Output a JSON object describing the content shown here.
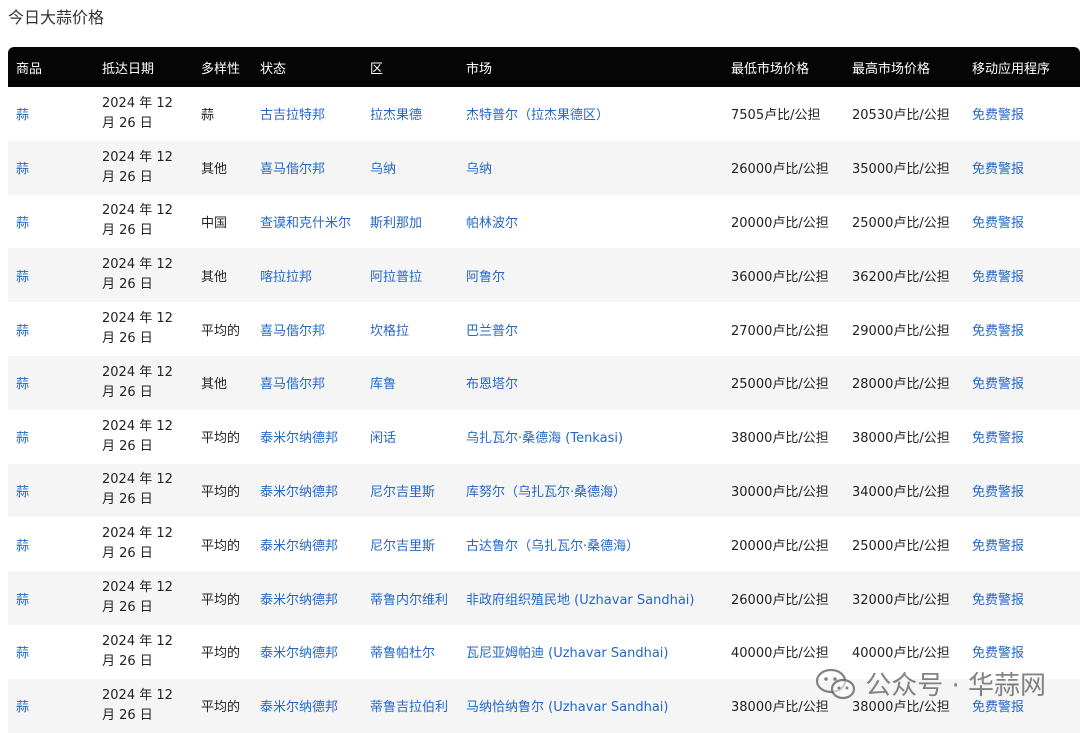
{
  "title": "今日大蒜价格",
  "columns": [
    "商品",
    "抵达日期",
    "多样性",
    "状态",
    "区",
    "市场",
    "最低市场价格",
    "最高市场价格",
    "移动应用程序"
  ],
  "rows": [
    {
      "commodity": "蒜",
      "date": "2024 年 12 月 26 日",
      "variety": "蒜",
      "state": "古吉拉特邦",
      "district": "拉杰果德",
      "market": "杰特普尔（拉杰果德区）",
      "min": "7505卢比/公担",
      "max": "20530卢比/公担",
      "app": "免费警报"
    },
    {
      "commodity": "蒜",
      "date": "2024 年 12 月 26 日",
      "variety": "其他",
      "state": "喜马偕尔邦",
      "district": "乌纳",
      "market": "乌纳",
      "min": "26000卢比/公担",
      "max": "35000卢比/公担",
      "app": "免费警报"
    },
    {
      "commodity": "蒜",
      "date": "2024 年 12 月 26 日",
      "variety": "中国",
      "state": "查谟和克什米尔",
      "district": "斯利那加",
      "market": "帕林波尔",
      "min": "20000卢比/公担",
      "max": "25000卢比/公担",
      "app": "免费警报"
    },
    {
      "commodity": "蒜",
      "date": "2024 年 12 月 26 日",
      "variety": "其他",
      "state": "喀拉拉邦",
      "district": "阿拉普拉",
      "market": "阿鲁尔",
      "min": "36000卢比/公担",
      "max": "36200卢比/公担",
      "app": "免费警报"
    },
    {
      "commodity": "蒜",
      "date": "2024 年 12 月 26 日",
      "variety": "平均的",
      "state": "喜马偕尔邦",
      "district": "坎格拉",
      "market": "巴兰普尔",
      "min": "27000卢比/公担",
      "max": "29000卢比/公担",
      "app": "免费警报"
    },
    {
      "commodity": "蒜",
      "date": "2024 年 12 月 26 日",
      "variety": "其他",
      "state": "喜马偕尔邦",
      "district": "库鲁",
      "market": "布恩塔尔",
      "min": "25000卢比/公担",
      "max": "28000卢比/公担",
      "app": "免费警报"
    },
    {
      "commodity": "蒜",
      "date": "2024 年 12 月 26 日",
      "variety": "平均的",
      "state": "泰米尔纳德邦",
      "district": "闲话",
      "market": "乌扎瓦尔·桑德海 (Tenkasi)",
      "min": "38000卢比/公担",
      "max": "38000卢比/公担",
      "app": "免费警报"
    },
    {
      "commodity": "蒜",
      "date": "2024 年 12 月 26 日",
      "variety": "平均的",
      "state": "泰米尔纳德邦",
      "district": "尼尔吉里斯",
      "market": "库努尔（乌扎瓦尔·桑德海）",
      "min": "30000卢比/公担",
      "max": "34000卢比/公担",
      "app": "免费警报"
    },
    {
      "commodity": "蒜",
      "date": "2024 年 12 月 26 日",
      "variety": "平均的",
      "state": "泰米尔纳德邦",
      "district": "尼尔吉里斯",
      "market": "古达鲁尔（乌扎瓦尔·桑德海）",
      "min": "20000卢比/公担",
      "max": "25000卢比/公担",
      "app": "免费警报"
    },
    {
      "commodity": "蒜",
      "date": "2024 年 12 月 26 日",
      "variety": "平均的",
      "state": "泰米尔纳德邦",
      "district": "蒂鲁内尔维利",
      "market": "非政府组织殖民地 (Uzhavar Sandhai)",
      "min": "26000卢比/公担",
      "max": "32000卢比/公担",
      "app": "免费警报"
    },
    {
      "commodity": "蒜",
      "date": "2024 年 12 月 26 日",
      "variety": "平均的",
      "state": "泰米尔纳德邦",
      "district": "蒂鲁帕杜尔",
      "market": "瓦尼亚姆帕迪 (Uzhavar Sandhai)",
      "min": "40000卢比/公担",
      "max": "40000卢比/公担",
      "app": "免费警报"
    },
    {
      "commodity": "蒜",
      "date": "2024 年 12 月 26 日",
      "variety": "平均的",
      "state": "泰米尔纳德邦",
      "district": "蒂鲁吉拉伯利",
      "market": "马纳恰纳鲁尔 (Uzhavar Sandhai)",
      "min": "38000卢比/公担",
      "max": "38000卢比/公担",
      "app": "免费警报"
    }
  ],
  "watermark": {
    "text": "公众号 · 华蒜网",
    "icon": "wechat-icon"
  },
  "colors": {
    "header_bg": "#050505",
    "link": "#2468c6",
    "stripe": "#f5f5f5"
  }
}
